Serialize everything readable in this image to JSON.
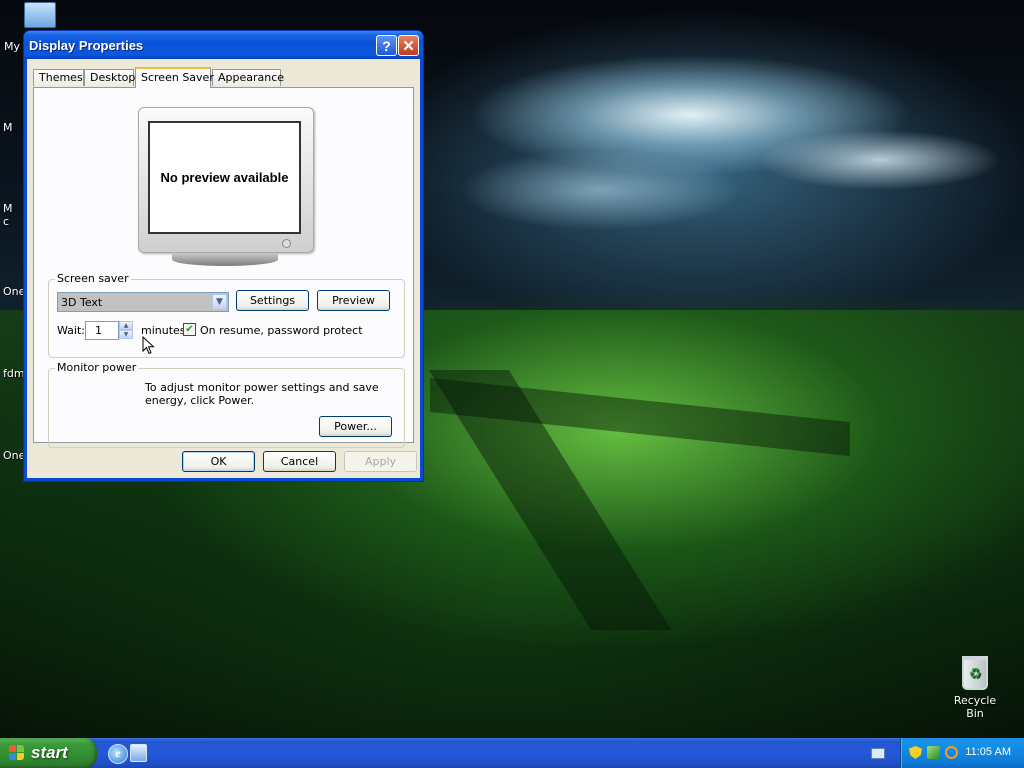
{
  "desktop": {
    "icons": {
      "my_computer": "My",
      "partial_1": "M",
      "partial_2": "M",
      "partial_2b": "c",
      "partial_3": "One",
      "partial_4": "fdm",
      "partial_5": "One",
      "recycle_bin": "Recycle Bin"
    }
  },
  "window": {
    "title": "Display Properties",
    "help_glyph": "?",
    "close_glyph": "✕",
    "tabs": [
      {
        "label": "Themes",
        "active": false
      },
      {
        "label": "Desktop",
        "active": false
      },
      {
        "label": "Screen Saver",
        "active": true
      },
      {
        "label": "Appearance",
        "active": false
      }
    ],
    "preview_text": "No preview available",
    "screen_saver": {
      "group_label": "Screen saver",
      "selected": "3D Text",
      "settings_button": "Settings",
      "preview_button": "Preview",
      "wait_label": "Wait:",
      "wait_value": "1",
      "minutes_label": "minutes",
      "password_protect_label": "On resume, password protect",
      "password_protect_checked": true
    },
    "monitor_power": {
      "group_label": "Monitor power",
      "description": "To adjust monitor power settings and save energy, click Power.",
      "power_button": "Power..."
    },
    "buttons": {
      "ok": "OK",
      "cancel": "Cancel",
      "apply": "Apply"
    }
  },
  "taskbar": {
    "start_label": "start",
    "clock": "11:05 AM"
  }
}
